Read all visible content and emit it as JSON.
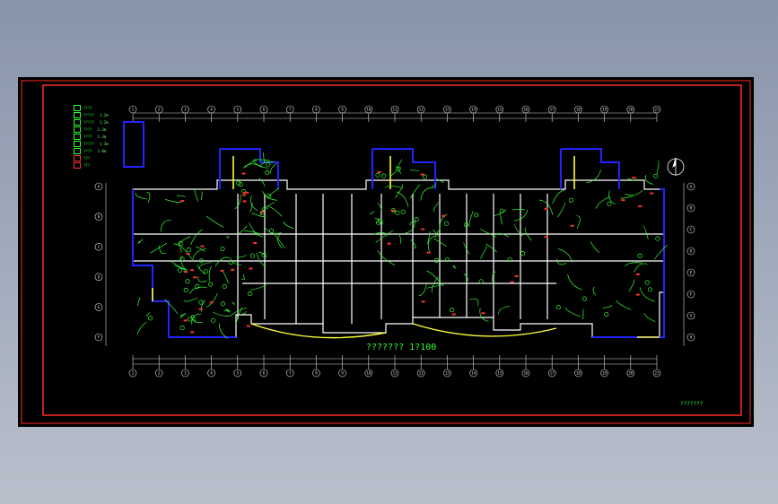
{
  "drawing": {
    "plan_title": "???????  1?100",
    "sheet_label": "???????",
    "colors": {
      "background": "#000000",
      "frame": "#ff2a2a",
      "wall": "#ffffff",
      "column": "#2323ff",
      "wiring": "#33ff33",
      "fixture": "#ff3030",
      "highlight": "#ffff33",
      "dimension": "#e0e0e0"
    },
    "legend": [
      {
        "label": "????",
        "value": ""
      },
      {
        "label": "?????",
        "value": "1.2m"
      },
      {
        "label": "?????",
        "value": "1.2m"
      },
      {
        "label": "????",
        "value": "1.3m"
      },
      {
        "label": "????",
        "value": "1.3m"
      },
      {
        "label": "?????",
        "value": "1.3m"
      },
      {
        "label": "????",
        "value": "1.8m"
      },
      {
        "label": "???",
        "value": ""
      },
      {
        "label": "???",
        "value": ""
      }
    ],
    "axis_labels_top": [
      "1",
      "2",
      "3",
      "4",
      "5",
      "6",
      "7",
      "8",
      "9",
      "10",
      "11",
      "12",
      "13",
      "14",
      "15",
      "16",
      "17",
      "18",
      "19",
      "20",
      "21"
    ],
    "axis_labels_bottom": [
      "1",
      "2",
      "3",
      "4",
      "5",
      "6",
      "7",
      "8",
      "9",
      "10",
      "11",
      "12",
      "13",
      "14",
      "15",
      "16",
      "17",
      "18",
      "19",
      "20",
      "21"
    ],
    "axis_labels_left": [
      "A",
      "B",
      "C",
      "D",
      "E",
      "F"
    ],
    "axis_labels_right": [
      "A",
      "B",
      "C",
      "D",
      "E",
      "F",
      "G",
      "H"
    ]
  }
}
